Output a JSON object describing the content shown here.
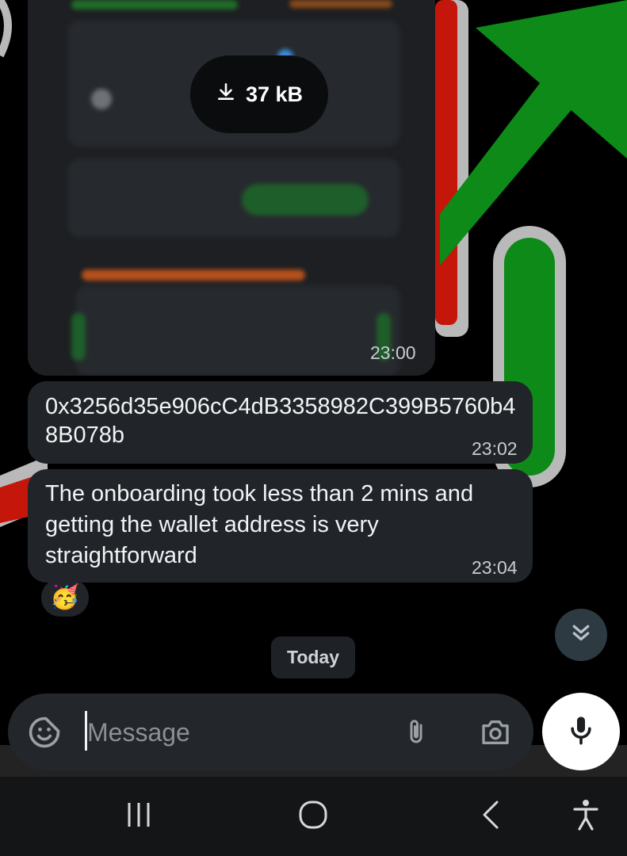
{
  "image_message": {
    "download_size": "37 kB",
    "time": "23:00"
  },
  "messages": [
    {
      "text": "0x3256d35e906cC4dB3358982C399B5760b48B078b",
      "time": "23:02"
    },
    {
      "text": "The onboarding took less than 2 mins and getting the wallet address is very straightforward",
      "time": "23:04"
    }
  ],
  "reaction": {
    "emoji": "🥳"
  },
  "date_separator": "Today",
  "composer": {
    "placeholder": "Message",
    "icons": [
      "sticker-icon",
      "paperclip-icon",
      "camera-icon",
      "microphone-icon"
    ]
  },
  "scroll_down_icon": "double-chevron-down-icon",
  "navbar": {
    "icons": [
      "recent-apps-icon",
      "home-icon",
      "back-icon",
      "accessibility-icon"
    ]
  },
  "colors": {
    "bubble": "#212529",
    "background": "#000000",
    "wallpaper_green": "#0d8a17",
    "wallpaper_red": "#c4160b",
    "wallpaper_gray": "#b9b9b9"
  }
}
